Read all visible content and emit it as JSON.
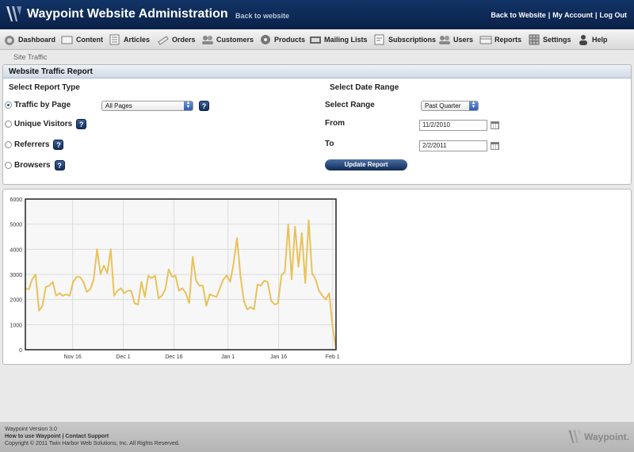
{
  "header": {
    "title": "Waypoint Website Administration",
    "back_link": "Back to website",
    "links": [
      "Back to Website",
      "My Account",
      "Log Out"
    ]
  },
  "nav": [
    {
      "label": "Dashboard",
      "icon": "dashboard-icon"
    },
    {
      "label": "Content",
      "icon": "content-icon"
    },
    {
      "label": "Articles",
      "icon": "articles-icon"
    },
    {
      "label": "Orders",
      "icon": "orders-icon"
    },
    {
      "label": "Customers",
      "icon": "customers-icon"
    },
    {
      "label": "Products",
      "icon": "products-icon"
    },
    {
      "label": "Mailing Lists",
      "icon": "mailing-lists-icon"
    },
    {
      "label": "Subscriptions",
      "icon": "subscriptions-icon"
    },
    {
      "label": "Users",
      "icon": "users-icon"
    },
    {
      "label": "Reports",
      "icon": "reports-icon"
    },
    {
      "label": "Settings",
      "icon": "settings-icon"
    },
    {
      "label": "Help",
      "icon": "help-icon"
    }
  ],
  "breadcrumb": "Site Traffic",
  "report": {
    "panel_title": "Website Traffic Report",
    "type_heading": "Select Report Type",
    "date_heading": "Select Date Range",
    "types": [
      {
        "label": "Traffic by Page",
        "selected": true
      },
      {
        "label": "Unique Visitors",
        "selected": false
      },
      {
        "label": "Referrers",
        "selected": false
      },
      {
        "label": "Browsers",
        "selected": false
      }
    ],
    "page_select": "All Pages",
    "help_glyph": "?",
    "range_label": "Select Range",
    "range_value": "Past Quarter",
    "from_label": "From",
    "from_value": "11/2/2010",
    "to_label": "To",
    "to_value": "2/2/2011",
    "update_button": "Update Report"
  },
  "chart_data": {
    "type": "line",
    "ylim": [
      0,
      6000
    ],
    "y_ticks": [
      "0",
      "1000",
      "2000",
      "3000",
      "4000",
      "5000",
      "6000"
    ],
    "x_tick_labels": [
      "Nov 16",
      "Dec 1",
      "Dec 16",
      "Jan 1",
      "Jan 16",
      "Feb 1"
    ],
    "x_range": [
      "2010-11-02",
      "2011-02-02"
    ],
    "line_color": "#e8c25a",
    "grid": true,
    "series": [
      {
        "values": [
          2450,
          2400,
          2800,
          3000,
          1550,
          1750,
          2500,
          2550,
          2700,
          2150,
          2250,
          2150,
          2200,
          2150,
          2700,
          2900,
          2900,
          2700,
          2300,
          2400,
          2800,
          4000,
          3000,
          3350,
          3050,
          4000,
          2150,
          2350,
          2450,
          2250,
          2350,
          2350,
          1850,
          1800,
          2700,
          2100,
          2950,
          2850,
          2950,
          2050,
          2150,
          2400,
          3200,
          2900,
          2950,
          2350,
          2450,
          2250,
          1850,
          3700,
          2750,
          2550,
          2550,
          1750,
          2200,
          2150,
          2100,
          2450,
          2800,
          2950,
          2700,
          3450,
          4450,
          2950,
          1950,
          1600,
          1700,
          1600,
          2600,
          2550,
          2750,
          2700,
          1950,
          1800,
          1850,
          2950,
          3100,
          5000,
          2800,
          4900,
          3300,
          4650,
          2650,
          5150,
          3050,
          2800,
          2350,
          2150,
          2000,
          2250,
          900,
          50
        ]
      }
    ]
  },
  "footer": {
    "version": "Waypoint Version 3.0",
    "how_to": "How to use Waypoint",
    "sep": "|",
    "support": "Contact Support",
    "copyright": "Copyright © 2011 Twin Harbor Web Solutions, Inc. All Rights Reserved.",
    "brand": "Waypoint."
  }
}
